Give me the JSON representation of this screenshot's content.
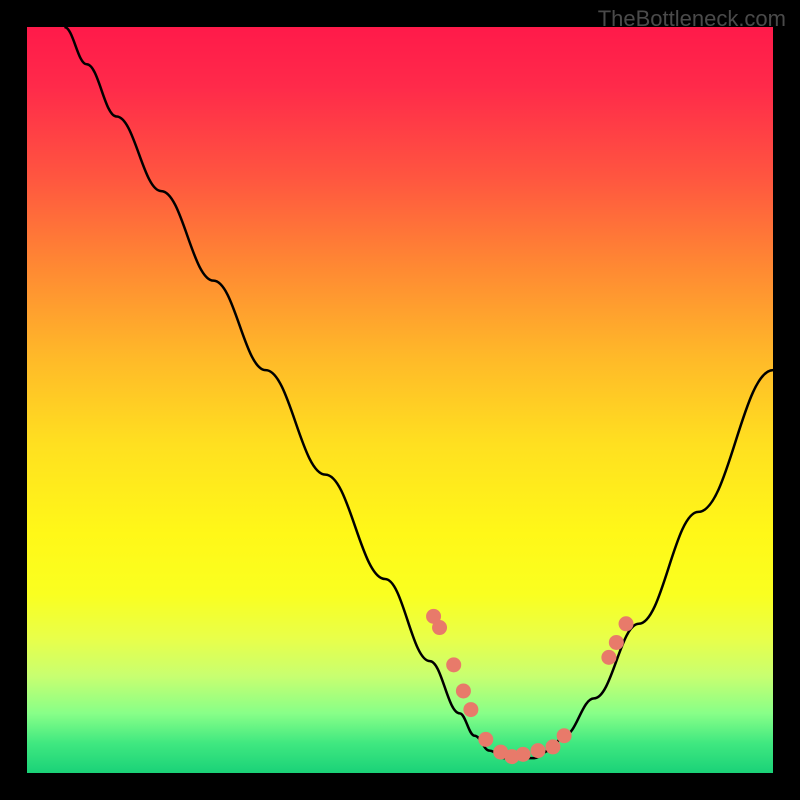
{
  "watermark": "TheBottleneck.com",
  "chart_data": {
    "type": "line",
    "title": "",
    "xlabel": "",
    "ylabel": "",
    "xlim": [
      0,
      100
    ],
    "ylim": [
      0,
      100
    ],
    "curve": {
      "x": [
        5,
        8,
        12,
        18,
        25,
        32,
        40,
        48,
        54,
        58,
        60,
        62,
        64,
        66,
        68,
        70,
        72,
        76,
        82,
        90,
        100
      ],
      "y": [
        100,
        95,
        88,
        78,
        66,
        54,
        40,
        26,
        15,
        8,
        5,
        3,
        2,
        2,
        2,
        3,
        5,
        10,
        20,
        35,
        54
      ]
    },
    "markers": {
      "x": [
        54.5,
        55.3,
        57.2,
        58.5,
        59.5,
        61.5,
        63.5,
        65.0,
        66.5,
        68.5,
        70.5,
        72.0,
        78.0,
        79.0,
        80.3
      ],
      "y": [
        21.0,
        19.5,
        14.5,
        11.0,
        8.5,
        4.5,
        2.8,
        2.2,
        2.5,
        3.0,
        3.5,
        5.0,
        15.5,
        17.5,
        20.0
      ],
      "color": "#e87a6a"
    },
    "gradient_colors": [
      "#ff1a4a",
      "#ffb829",
      "#fff818",
      "#1ad278"
    ]
  }
}
